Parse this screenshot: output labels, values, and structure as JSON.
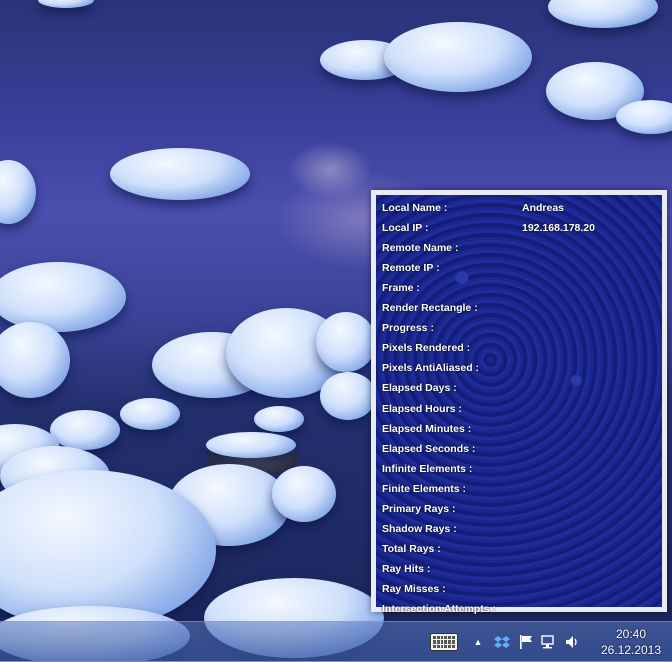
{
  "panel": {
    "rows": [
      {
        "label": "Local Name :",
        "value": "Andreas"
      },
      {
        "label": "Local IP :",
        "value": "192.168.178.20"
      },
      {
        "label": "Remote Name :",
        "value": ""
      },
      {
        "label": "Remote IP :",
        "value": ""
      },
      {
        "label": "Frame :",
        "value": ""
      },
      {
        "label": "Render Rectangle :",
        "value": ""
      },
      {
        "label": "Progress :",
        "value": ""
      },
      {
        "label": "Pixels Rendered :",
        "value": ""
      },
      {
        "label": "Pixels AntiAliased :",
        "value": ""
      },
      {
        "label": "Elapsed Days :",
        "value": ""
      },
      {
        "label": "Elapsed Hours :",
        "value": ""
      },
      {
        "label": "Elapsed Minutes :",
        "value": ""
      },
      {
        "label": "Elapsed Seconds :",
        "value": ""
      },
      {
        "label": "Infinite Elements :",
        "value": ""
      },
      {
        "label": "Finite Elements :",
        "value": ""
      },
      {
        "label": "Primary Rays :",
        "value": ""
      },
      {
        "label": "Shadow Rays :",
        "value": ""
      },
      {
        "label": "Total Rays :",
        "value": ""
      },
      {
        "label": "Ray Hits :",
        "value": ""
      },
      {
        "label": "Ray Misses :",
        "value": ""
      },
      {
        "label": "Intersection Attempts :",
        "value": ""
      }
    ]
  },
  "taskbar": {
    "tray_icons": [
      "keyboard-icon",
      "show-hidden-icons-chevron-icon",
      "dropbox-icon",
      "action-center-flag-icon",
      "network-icon",
      "volume-icon"
    ],
    "time": "20:40",
    "date": "26.12.2013"
  }
}
